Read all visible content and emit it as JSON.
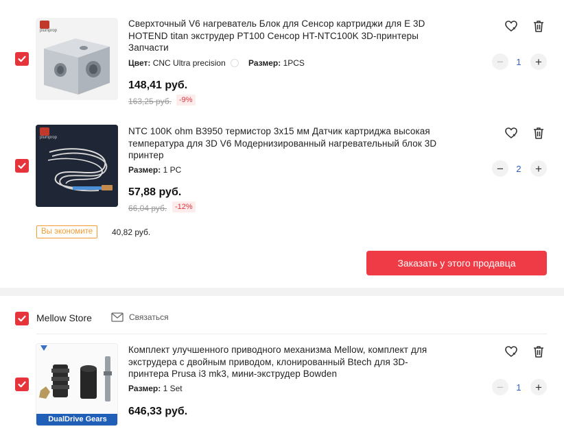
{
  "items": [
    {
      "title": "Сверхточный V6 нагреватель Блок для Сенсор картриджи для E 3D HOTEND titan экструдер PT100 Сенсор HT-NTC100K 3D-принтеры Запчасти",
      "attr1_label": "Цвет:",
      "attr1_value": "CNC Ultra precision",
      "attr2_label": "Размер:",
      "attr2_value": "1PCS",
      "price": "148,41 руб.",
      "old_price": "163,25 руб.",
      "discount": "-9%",
      "quantity": "1",
      "logo_text": "plumprop"
    },
    {
      "title": "NTC 100K ohm B3950 термистор 3x15 мм Датчик картриджа высокая температура для 3D V6 Модернизированный нагревательный блок 3D принтер",
      "attr1_label": "Размер:",
      "attr1_value": "1 PC",
      "price": "57,88 руб.",
      "old_price": "66,04 руб.",
      "discount": "-12%",
      "quantity": "2",
      "logo_text": "plumprop"
    },
    {
      "title": "Комплект улучшенного приводного механизма Mellow, комплект для экструдера с двойным приводом, клонированный Btech для 3D-принтера Prusa i3 mk3, мини-экструдер Bowden",
      "attr1_label": "Размер:",
      "attr1_value": "1 Set",
      "price": "646,33 руб.",
      "quantity": "1",
      "image_caption": "DualDrive Gears"
    }
  ],
  "savings": {
    "label": "Вы экономите",
    "amount": "40,82 руб."
  },
  "order_button": "Заказать у этого продавца",
  "store": {
    "name": "Mellow Store",
    "contact_label": "Связаться"
  },
  "colors": {
    "accent": "#ef3b45",
    "savings_orange": "#f39c33",
    "qty_blue": "#2a5fc4"
  },
  "icons": {
    "wishlist": "heart-icon",
    "delete": "trash-icon",
    "select": "checkmark-icon",
    "contact": "envelope-icon"
  }
}
